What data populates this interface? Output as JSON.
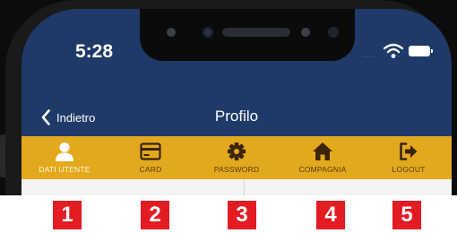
{
  "status_bar": {
    "time": "5:28",
    "signal_dots": "....",
    "wifi_icon": "wifi-icon",
    "battery_icon": "battery-icon"
  },
  "navbar": {
    "back_label": "Indietro",
    "title": "Profilo"
  },
  "tabs": [
    {
      "label": "DATI UTENTE",
      "icon": "user-icon",
      "active": true
    },
    {
      "label": "CARD",
      "icon": "card-icon",
      "active": false
    },
    {
      "label": "PASSWORD",
      "icon": "gear-icon",
      "active": false
    },
    {
      "label": "COMPAGNIA",
      "icon": "home-icon",
      "active": false
    },
    {
      "label": "LOGOUT",
      "icon": "logout-icon",
      "active": false
    }
  ],
  "badges": [
    "1",
    "2",
    "3",
    "4",
    "5"
  ],
  "colors": {
    "header_bg": "#1f3a68",
    "tabbar_bg": "#e3a91e",
    "badge_bg": "#e31b23"
  }
}
